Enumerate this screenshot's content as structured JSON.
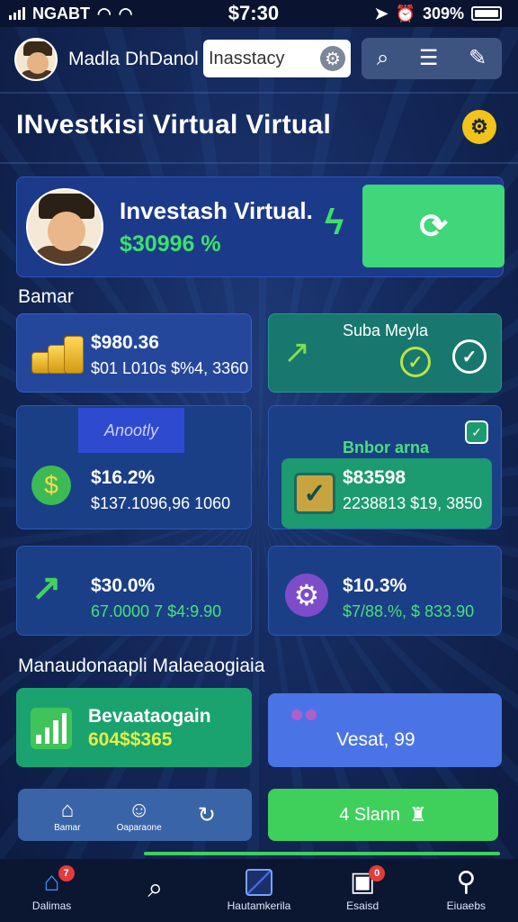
{
  "status_bar": {
    "carrier": "NGABT",
    "time": "$7:30",
    "battery": "309%"
  },
  "header": {
    "username": "Madla DhDanol",
    "search_value": "Inasstacy"
  },
  "title": "INvestkisi Virtual Virtual",
  "hero": {
    "title": "Investash Virtual.",
    "value": "$30996 %"
  },
  "section_1": "Bamar",
  "cards": {
    "coins": {
      "value": "$980.36",
      "sub": "$01 L010s $%4, 3360"
    },
    "subs": {
      "title": "Suba Meyla"
    },
    "money": {
      "tag": "Anootly",
      "value": "$16.2%",
      "sub": "$137.1096,96 1060"
    },
    "bri": {
      "title": "Bnbor arna",
      "value": "$83598",
      "sub": "2238813 $19, 3850"
    },
    "arrow": {
      "value": "$30.0%",
      "sub": "67.0000 7 $4:9.90"
    },
    "gear": {
      "value": "$10.3%",
      "sub": "$7/88.%, $ 833.90"
    }
  },
  "section_2": "Manaudonaapli Malaeaogiaia",
  "bottom_cards": {
    "bev": {
      "title": "Bevaataogain",
      "value": "604$$365"
    },
    "vesat": {
      "label": "Vesat, 99"
    }
  },
  "actions": {
    "home": "Bamar",
    "operations": "Oaparaone",
    "slann": "4 Slann"
  },
  "tabs": [
    {
      "label": "Dalimas",
      "badge": "7"
    },
    {
      "label": "",
      "badge": ""
    },
    {
      "label": "Hautamkerila",
      "badge": ""
    },
    {
      "label": "Esaisd",
      "badge": "0"
    },
    {
      "label": "Eiuaebs",
      "badge": ""
    }
  ],
  "colors": {
    "accent_green": "#3fd77a",
    "panel_blue": "#24479c",
    "panel_teal": "#18776e"
  }
}
